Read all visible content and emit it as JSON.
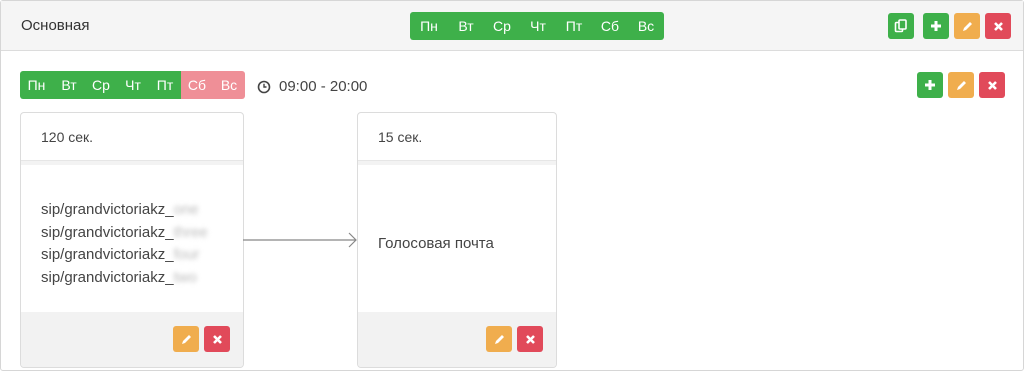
{
  "header": {
    "title": "Основная",
    "days": [
      {
        "label": "Пн",
        "active": true
      },
      {
        "label": "Вт",
        "active": true
      },
      {
        "label": "Ср",
        "active": true
      },
      {
        "label": "Чт",
        "active": true
      },
      {
        "label": "Пт",
        "active": true
      },
      {
        "label": "Сб",
        "active": true
      },
      {
        "label": "Вс",
        "active": true
      }
    ],
    "actions": [
      "copy-icon",
      "plus-icon",
      "pencil-icon",
      "close-icon"
    ]
  },
  "rule": {
    "days": [
      {
        "label": "Пн",
        "active": true
      },
      {
        "label": "Вт",
        "active": true
      },
      {
        "label": "Ср",
        "active": true
      },
      {
        "label": "Чт",
        "active": true
      },
      {
        "label": "Пт",
        "active": true
      },
      {
        "label": "Сб",
        "active": false
      },
      {
        "label": "Вс",
        "active": false
      }
    ],
    "time_range": "09:00 - 20:00",
    "actions": [
      "plus-icon",
      "pencil-icon",
      "close-icon"
    ]
  },
  "steps": [
    {
      "timeout": "120 сек.",
      "destinations": [
        {
          "prefix": "sip/grandvictoriakz_",
          "suffix": "one"
        },
        {
          "prefix": "sip/grandvictoriakz_",
          "suffix": "three"
        },
        {
          "prefix": "sip/grandvictoriakz_",
          "suffix": "four"
        },
        {
          "prefix": "sip/grandvictoriakz_",
          "suffix": "two"
        }
      ]
    },
    {
      "timeout": "15 сек.",
      "destination": "Голосовая почта"
    }
  ],
  "colors": {
    "active_day": "#3eb04a",
    "inactive_day": "#ef8f97",
    "add": "#3eb04a",
    "edit": "#f0ad4e",
    "delete": "#e14a5a"
  }
}
